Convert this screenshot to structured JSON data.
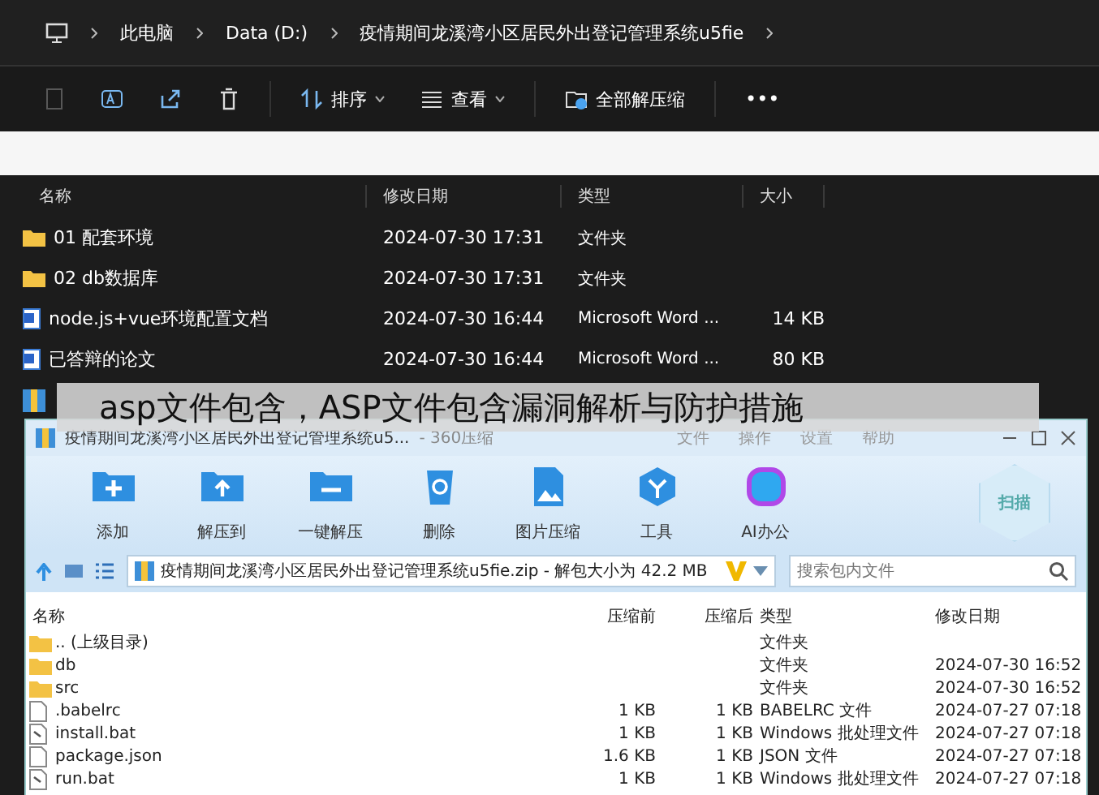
{
  "explorer": {
    "breadcrumb": [
      "此电脑",
      "Data (D:)",
      "疫情期间龙溪湾小区居民外出登记管理系统u5fie"
    ],
    "toolbar": [
      {
        "kind": "copy",
        "disabled": true
      },
      {
        "kind": "rename",
        "disabled": false
      },
      {
        "kind": "share",
        "disabled": false
      },
      {
        "kind": "delete",
        "disabled": false
      },
      {
        "kind": "sort",
        "label": "排序",
        "disabled": false
      },
      {
        "kind": "view",
        "label": "查看",
        "disabled": false
      },
      {
        "kind": "extract",
        "label": "全部解压缩",
        "disabled": false
      },
      {
        "kind": "more",
        "label": "•••",
        "disabled": false
      }
    ],
    "columns": [
      "名称",
      "修改日期",
      "类型",
      "大小"
    ],
    "rows": [
      {
        "kind": "folder",
        "name": "01 配套环境",
        "date": "2024-07-30 17:31",
        "type": "文件夹"
      },
      {
        "kind": "folder",
        "name": "02 db数据库",
        "date": "2024-07-30 17:31",
        "type": "文件夹"
      },
      {
        "kind": "word",
        "name": "node.js+vue环境配置文档",
        "date": "2024-07-30 16:44",
        "type": "Microsoft Word ...",
        "size": "14 KB"
      },
      {
        "kind": "word",
        "name": "已答辩的论文",
        "date": "2024-07-30 16:44",
        "type": "Microsoft Word ...",
        "size": "80 KB"
      },
      {
        "kind": "zip"
      }
    ]
  },
  "caption": "asp文件包含，ASP文件包含漏洞解析与防护措施",
  "zip": {
    "title": "疫情期间龙溪湾小区居民外出登记管理系统u5...",
    "app": "- 360压缩",
    "menu": [
      "文件",
      "操作",
      "设置",
      "帮助"
    ],
    "tools": [
      {
        "kind": "add",
        "label": "添加"
      },
      {
        "kind": "extract-to",
        "label": "解压到"
      },
      {
        "kind": "one-click",
        "label": "一键解压"
      },
      {
        "kind": "delete",
        "label": "删除"
      },
      {
        "kind": "image",
        "label": "图片压缩"
      },
      {
        "kind": "tools",
        "label": "工具"
      },
      {
        "kind": "ai",
        "label": "AI办公"
      }
    ],
    "scan": "扫描",
    "address": "疫情期间龙溪湾小区居民外出登记管理系统u5fie.zip - 解包大小为 42.2 MB",
    "search": {
      "placeholder": "搜索包内文件"
    },
    "columns": [
      "名称",
      "压缩前",
      "压缩后",
      "类型",
      "修改日期"
    ],
    "rows": [
      {
        "kind": "folder",
        "name": ".. (上级目录)",
        "type": "文件夹"
      },
      {
        "kind": "folder",
        "name": "db",
        "type": "文件夹",
        "date": "2024-07-30 16:52"
      },
      {
        "kind": "folder",
        "name": "src",
        "type": "文件夹",
        "date": "2024-07-30 16:52"
      },
      {
        "kind": "file",
        "name": ".babelrc",
        "before": "1 KB",
        "after": "1 KB",
        "type": "BABELRC 文件",
        "date": "2024-07-27 07:18"
      },
      {
        "kind": "bat",
        "name": "install.bat",
        "before": "1 KB",
        "after": "1 KB",
        "type": "Windows 批处理文件",
        "date": "2024-07-27 07:18"
      },
      {
        "kind": "file",
        "name": "package.json",
        "before": "1.6 KB",
        "after": "1 KB",
        "type": "JSON 文件",
        "date": "2024-07-27 07:18"
      },
      {
        "kind": "bat",
        "name": "run.bat",
        "before": "1 KB",
        "after": "1 KB",
        "type": "Windows 批处理文件",
        "date": "2024-07-27 07:18"
      }
    ]
  }
}
